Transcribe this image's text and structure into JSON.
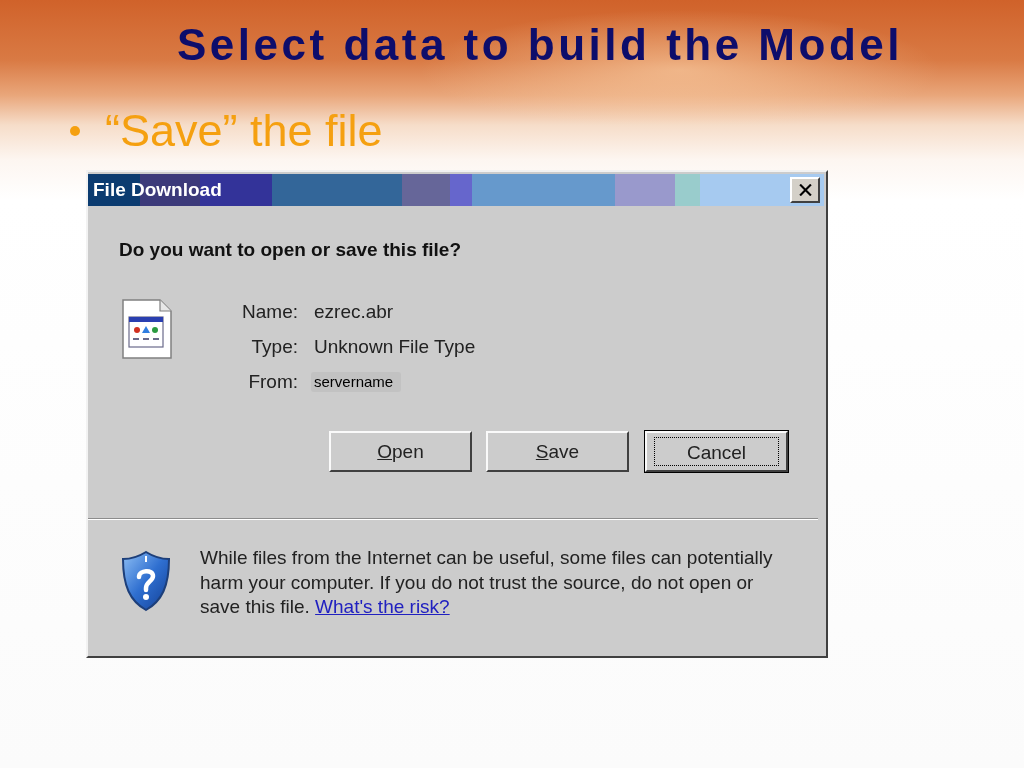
{
  "slide": {
    "title": "Select data to build the Model",
    "bullets": [
      {
        "text": "“Save” the file"
      }
    ]
  },
  "dialog": {
    "title": "File Download",
    "question": "Do you want to open or save this file?",
    "fields": [
      {
        "label": "Name:",
        "value": "ezrec.abr",
        "highlighted": false
      },
      {
        "label": "Type:",
        "value": "Unknown File Type",
        "highlighted": false
      },
      {
        "label": "From:",
        "value": "servername",
        "highlighted": true
      }
    ],
    "buttons": [
      {
        "label": "Open",
        "mnemonic": true,
        "focused": false
      },
      {
        "label": "Save",
        "mnemonic": true,
        "focused": false
      },
      {
        "label": "Cancel",
        "mnemonic": false,
        "focused": true
      }
    ],
    "warning": {
      "text": "While files from the Internet can be useful, some files can potentially harm your computer. If you do not trust the source, do not open or save this file.",
      "link": "What's the risk?"
    }
  }
}
